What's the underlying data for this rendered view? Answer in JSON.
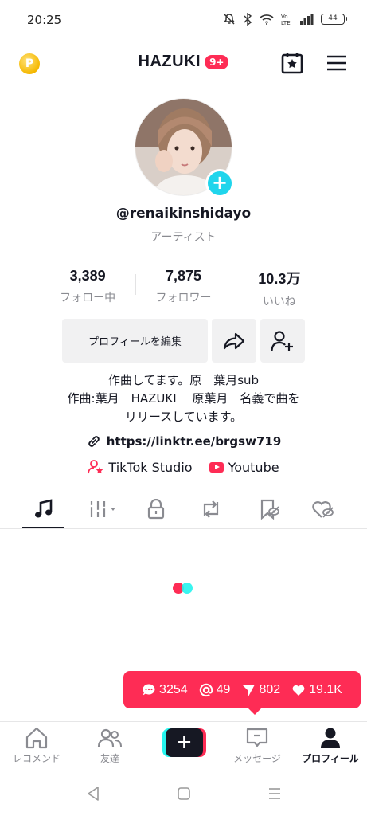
{
  "status_bar": {
    "time": "20:25",
    "battery": "44"
  },
  "header": {
    "title": "HAZUKI",
    "badge": "9+",
    "coin_label": "P"
  },
  "profile": {
    "username": "@renaikinshidayo",
    "role": "アーティスト",
    "add_label": "+"
  },
  "stats": [
    {
      "value": "3,389",
      "label": "フォロー中"
    },
    {
      "value": "7,875",
      "label": "フォロワー"
    },
    {
      "value": "10.3万",
      "label": "いいね"
    }
  ],
  "actions": {
    "edit_label": "プロフィールを編集"
  },
  "bio": {
    "lines": [
      "作曲してます。原　葉月sub",
      "作曲:葉月　HAZUKI　 原葉月　名義で曲を",
      "リリースしています。"
    ]
  },
  "link": {
    "text": "https://linktr.ee/brgsw719"
  },
  "services": {
    "studio": "TikTok Studio",
    "youtube": "Youtube"
  },
  "tabs": [
    {
      "icon": "music-icon",
      "active": true
    },
    {
      "icon": "playlist-icon",
      "active": false
    },
    {
      "icon": "lock-icon",
      "active": false
    },
    {
      "icon": "repost-icon",
      "active": false
    },
    {
      "icon": "bookmark-icon",
      "active": false
    },
    {
      "icon": "liked-icon",
      "active": false
    }
  ],
  "bubble": {
    "comments": "3254",
    "mentions": "49",
    "shares": "802",
    "likes": "19.1K"
  },
  "bottom_nav": {
    "home": "レコメンド",
    "friends": "友達",
    "create": "+",
    "inbox": "メッセージ",
    "profile": "プロフィール"
  },
  "colors": {
    "accent": "#fe2c55",
    "cyan": "#25f4ee",
    "text": "#161823",
    "muted": "#8a8b91"
  }
}
